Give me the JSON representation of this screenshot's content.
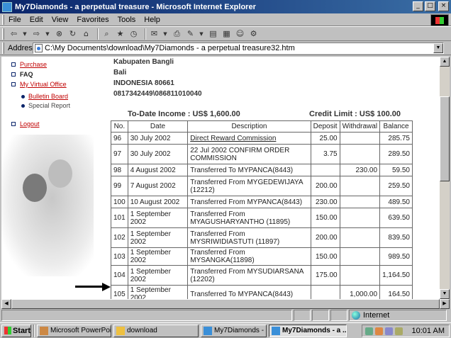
{
  "window": {
    "title": "My7Diamonds - a perpetual treasure - Microsoft Internet Explorer",
    "buttons": {
      "minimize": "_",
      "maximize": "□",
      "close": "×"
    }
  },
  "menu": [
    "File",
    "Edit",
    "View",
    "Favorites",
    "Tools",
    "Help"
  ],
  "toolbar_icons": [
    "back-icon",
    "forward-icon",
    "stop-icon",
    "refresh-icon",
    "home-icon",
    "search-icon",
    "favorites-icon",
    "history-icon",
    "mail-icon",
    "print-icon",
    "edit-icon",
    "discuss-icon",
    "messenger-icon"
  ],
  "address": {
    "label": "Address",
    "url": "C:\\My Documents\\download\\My7Diamonds - a perpetual treasure32.htm"
  },
  "sidebar": {
    "items": [
      {
        "label": "Purchase"
      },
      {
        "label": "FAQ"
      },
      {
        "label": "My Virtual Office"
      },
      {
        "label": "Bulletin Board"
      },
      {
        "label": "Special Report"
      },
      {
        "label": "Logout"
      }
    ]
  },
  "address_block": {
    "line1": "Kabupaten Bangli",
    "line2": "Bali",
    "line3": "INDONESIA   80661",
    "line4": "0817342449\\086811010040"
  },
  "summary": {
    "income": "To-Date Income : US$ 1,600.00",
    "credit": "Credit Limit : US$ 100.00"
  },
  "ledger": {
    "headers": [
      "No.",
      "Date",
      "Description",
      "Deposit",
      "Withdrawal",
      "Balance"
    ],
    "rows": [
      {
        "no": "96",
        "date": "30 July 2002",
        "desc": "Direct Reward Commission",
        "deposit": "25.00",
        "withdrawal": "",
        "balance": "285.75"
      },
      {
        "no": "97",
        "date": "30 July 2002",
        "desc": "22 Jul 2002 CONFIRM ORDER COMMISSION",
        "deposit": "3.75",
        "withdrawal": "",
        "balance": "289.50"
      },
      {
        "no": "98",
        "date": "4 August 2002",
        "desc": "Transferred To MYPANCA(8443)",
        "deposit": "",
        "withdrawal": "230.00",
        "balance": "59.50"
      },
      {
        "no": "99",
        "date": "7 August 2002",
        "desc": "Transferred From MYGEDEWIJAYA (12212)",
        "deposit": "200.00",
        "withdrawal": "",
        "balance": "259.50"
      },
      {
        "no": "100",
        "date": "10 August 2002",
        "desc": "Transferred From MYPANCA(8443)",
        "deposit": "230.00",
        "withdrawal": "",
        "balance": "489.50"
      },
      {
        "no": "101",
        "date": "1 September 2002",
        "desc": "Transferred From MYAGUSHARYANTHO (11895)",
        "deposit": "150.00",
        "withdrawal": "",
        "balance": "639.50"
      },
      {
        "no": "102",
        "date": "1 September 2002",
        "desc": "Transferred From MYSRIWIDIASTUTI (11897)",
        "deposit": "200.00",
        "withdrawal": "",
        "balance": "839.50"
      },
      {
        "no": "103",
        "date": "1 September 2002",
        "desc": "Transferred From MYSANGKA(11898)",
        "deposit": "150.00",
        "withdrawal": "",
        "balance": "989.50"
      },
      {
        "no": "104",
        "date": "1 September 2002",
        "desc": "Transferred From MYSUDIARSANA (12202)",
        "deposit": "175.00",
        "withdrawal": "",
        "balance": "1,164.50"
      },
      {
        "no": "105",
        "date": "1 September 2002",
        "desc": "Transferred To MYPANCA(8443)",
        "deposit": "",
        "withdrawal": "1,000.00",
        "balance": "164.50"
      }
    ]
  },
  "statusbar": {
    "zone": "Internet"
  },
  "taskbar": {
    "start": "Start",
    "tasks": [
      "Microsoft PowerPoint ...",
      "download",
      "My7Diamonds - a per...",
      "My7Diamonds - a ..."
    ],
    "clock": "10:01 AM"
  }
}
